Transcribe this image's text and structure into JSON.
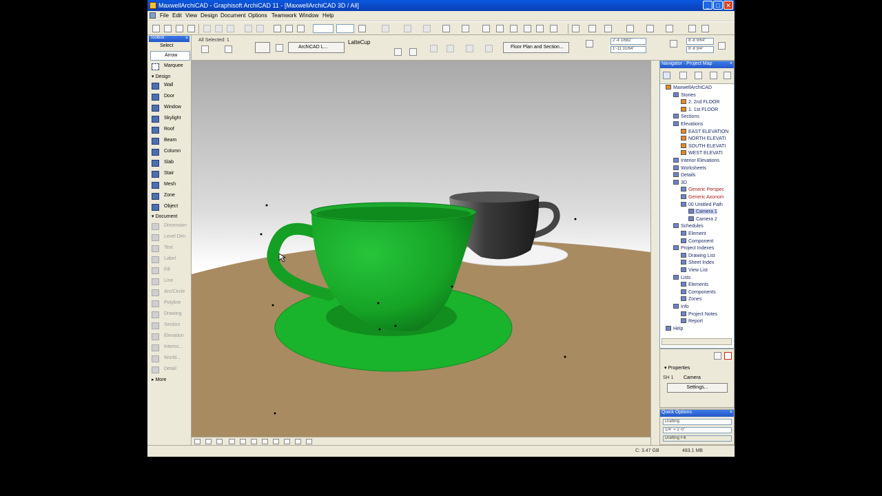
{
  "window": {
    "title": "MaxwellArchiCAD - Graphisoft ArchiCAD 11 - [MaxwellArchiCAD 3D / All]",
    "minimize": "_",
    "maximize": "□",
    "close": "✕"
  },
  "menu": [
    "File",
    "Edit",
    "View",
    "Design",
    "Document",
    "Options",
    "Teamwork",
    "Window",
    "Help"
  ],
  "infobox": {
    "selected": "All Selected: 1",
    "view_button": "ArchiCAD L...",
    "layer_name": "LatteCup",
    "floorplan_button": "Floor Plan and Section...",
    "coord1": "2'-4 1/682\"",
    "coord2": "1'-11 31/64\"",
    "coord3": "8'-8 9/64\"",
    "coord4": "8'-8 9/4\""
  },
  "toolbox": {
    "title": "Toolbox",
    "select_label": "Select",
    "arrow": "Arrow",
    "marquee": "Marquee",
    "design_label": "Design",
    "design_tools": [
      "Wall",
      "Door",
      "Window",
      "Skylight",
      "Roof",
      "Beam",
      "Column",
      "Slab",
      "Stair",
      "Mesh",
      "Zone",
      "Object"
    ],
    "document_label": "Document",
    "document_tools": [
      "Dimension",
      "Level Dim",
      "Text",
      "Label",
      "Fill",
      "Line",
      "Arc/Circle",
      "Polyline",
      "Drawing",
      "Section",
      "Elevation",
      "Interior...",
      "World...",
      "Detail"
    ],
    "more": "More"
  },
  "navigator": {
    "title": "Navigator · Project Map",
    "tree": [
      {
        "label": "MaxwellArchiCAD",
        "depth": 0,
        "style": "orange"
      },
      {
        "label": "Stories",
        "depth": 1
      },
      {
        "label": "2. 2nd FLOOR",
        "depth": 2,
        "style": "orange"
      },
      {
        "label": "1. 1st FLOOR",
        "depth": 2,
        "style": "orange"
      },
      {
        "label": "Sections",
        "depth": 1
      },
      {
        "label": "Elevations",
        "depth": 1
      },
      {
        "label": "EAST ELEVATION",
        "depth": 2,
        "style": "orange"
      },
      {
        "label": "NORTH ELEVATI",
        "depth": 2,
        "style": "orange"
      },
      {
        "label": "SOUTH ELEVATI",
        "depth": 2,
        "style": "orange"
      },
      {
        "label": "WEST ELEVATI",
        "depth": 2,
        "style": "orange"
      },
      {
        "label": "Interior Elevations",
        "depth": 1
      },
      {
        "label": "Worksheets",
        "depth": 1
      },
      {
        "label": "Details",
        "depth": 1
      },
      {
        "label": "3D",
        "depth": 1
      },
      {
        "label": "Generic Perspec",
        "depth": 2,
        "style": "red"
      },
      {
        "label": "Generic Axonom",
        "depth": 2,
        "style": "red"
      },
      {
        "label": "00 Untitled Path",
        "depth": 2
      },
      {
        "label": "Camera 1",
        "depth": 3,
        "style": "sel"
      },
      {
        "label": "Camera 2",
        "depth": 3
      },
      {
        "label": "Schedules",
        "depth": 1
      },
      {
        "label": "Element",
        "depth": 2
      },
      {
        "label": "Component",
        "depth": 2
      },
      {
        "label": "Project Indexes",
        "depth": 1
      },
      {
        "label": "Drawing List",
        "depth": 2
      },
      {
        "label": "Sheet Index",
        "depth": 2
      },
      {
        "label": "View List",
        "depth": 2
      },
      {
        "label": "Lists",
        "depth": 1
      },
      {
        "label": "Elements",
        "depth": 2
      },
      {
        "label": "Components",
        "depth": 2
      },
      {
        "label": "Zones",
        "depth": 2
      },
      {
        "label": "Info",
        "depth": 1
      },
      {
        "label": "Project Notes",
        "depth": 2
      },
      {
        "label": "Report",
        "depth": 2
      },
      {
        "label": "Help",
        "depth": 0
      }
    ]
  },
  "properties": {
    "title": "Properties",
    "id_label": "SH 1",
    "type": "Camera",
    "settings_button": "Settings..."
  },
  "quick_options": {
    "title": "Quick Options",
    "opt1": "Drafting",
    "opt2": "1/4\" = 1'-0\"",
    "opt3": "Drafting Fill"
  },
  "status": {
    "disk": "C: 3.47 GB",
    "ram": "483.1 MB"
  },
  "scene": {
    "table_color": "#a88b61",
    "green_cup": "#1aa528",
    "black_cup": "#444444"
  }
}
